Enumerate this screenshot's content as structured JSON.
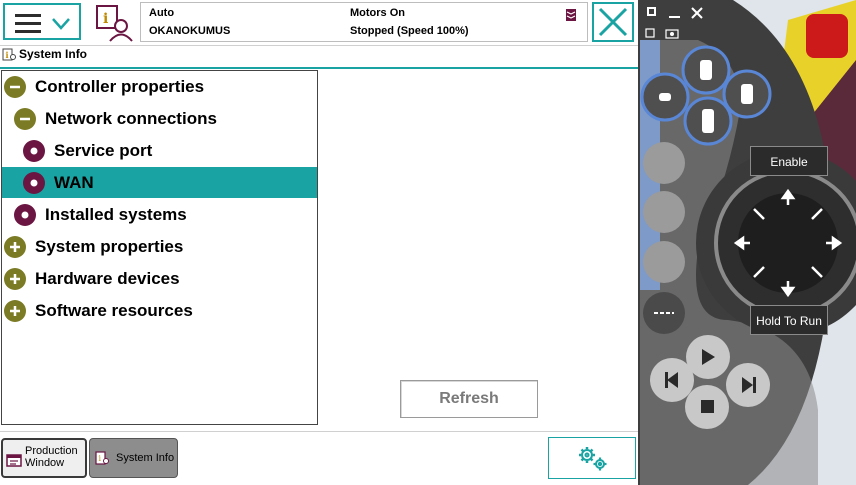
{
  "status": {
    "mode": "Auto",
    "system_name": "OKANOKUMUS",
    "motors": "Motors On",
    "state": "Stopped (Speed 100%)"
  },
  "window": {
    "title": "System Info"
  },
  "tree": [
    {
      "label": "Controller properties",
      "icon": "minus-icon",
      "level": 0,
      "selected": false
    },
    {
      "label": "Network connections",
      "icon": "minus-icon",
      "level": 1,
      "selected": false
    },
    {
      "label": "Service port",
      "icon": "dot-icon",
      "level": 2,
      "selected": false
    },
    {
      "label": "WAN",
      "icon": "dot-icon",
      "level": 2,
      "selected": true
    },
    {
      "label": "Installed systems",
      "icon": "dot-icon",
      "level": 1,
      "selected": false
    },
    {
      "label": "System properties",
      "icon": "plus-icon",
      "level": 0,
      "selected": false
    },
    {
      "label": "Hardware devices",
      "icon": "plus-icon",
      "level": 0,
      "selected": false
    },
    {
      "label": "Software resources",
      "icon": "plus-icon",
      "level": 0,
      "selected": false
    }
  ],
  "actions": {
    "refresh": "Refresh"
  },
  "taskbar": {
    "production_line1": "Production",
    "production_line2": "Window",
    "system_info": "System Info"
  },
  "pendant": {
    "enable": "Enable",
    "hold_to_run": "Hold To Run"
  },
  "colors": {
    "accent": "#1aa3a3",
    "olive": "#7b7b25",
    "maroon": "#6b1642"
  }
}
